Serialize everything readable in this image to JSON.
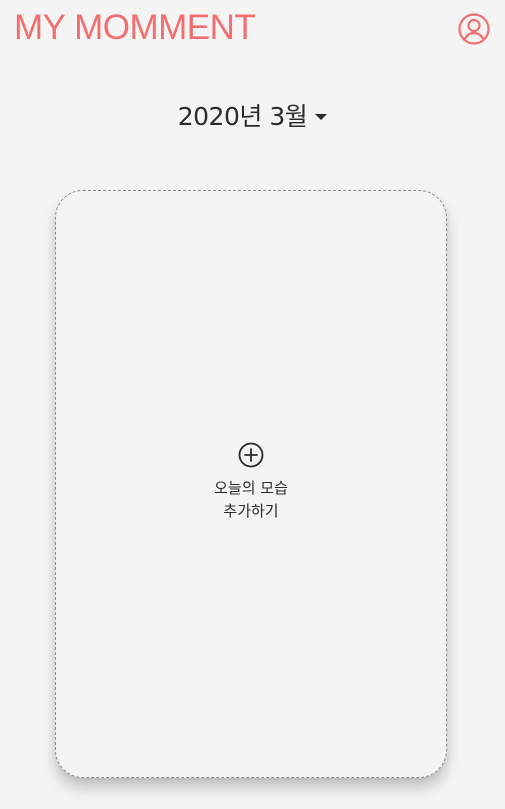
{
  "header": {
    "app_title": "MY MOMMENT",
    "brand_color": "#f36f6f",
    "profile_icon": "user-circle-icon"
  },
  "month_selector": {
    "label": "2020년 3월",
    "icon": "caret-down-icon"
  },
  "card": {
    "icon": "plus-circle-icon",
    "label_line1": "오늘의 모습",
    "label_line2": "추가하기"
  }
}
